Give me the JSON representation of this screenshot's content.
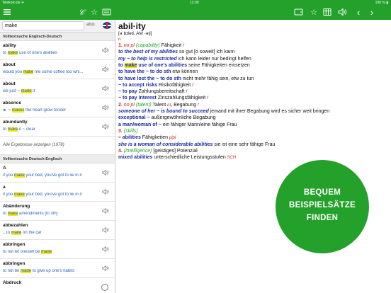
{
  "status": {
    "carrier": "Telekom.de ✈",
    "time": "12:00",
    "battery": "100 % ▮"
  },
  "icons": {
    "menu": "menu-icon",
    "handwriting": "handwriting-icon",
    "favorite": "star-icon",
    "keyboard": "keyboard-icon",
    "tablet": "tablet-icon",
    "table": "table-icon",
    "speaker": "speaker-icon",
    "back": "chevron-left-icon",
    "forward": "chevron-right-icon"
  },
  "colors": {
    "brand_green": "#23a12a",
    "highlight": "#f3e61a",
    "headword_blue": "#1c2a9e",
    "example_blue": "#2c63b8",
    "grammar_red": "#c22",
    "sense_green": "#22a32a"
  },
  "search": {
    "value": "make",
    "tool": "ab◎"
  },
  "left": {
    "section_en": "Volltextsuche Englisch-Deutsch",
    "en_results": [
      {
        "hw": "ability",
        "pre": "to ",
        "hl": "make",
        "post": " use of one's abilities"
      },
      {
        "hw": "about",
        "pre": "would you ",
        "hl": "make",
        "post": " me some coffee too whi..."
      },
      {
        "hw": "about",
        "pre": "we just ~ ",
        "hl": "made",
        "post": " it"
      },
      {
        "hw": "absence",
        "pre": "► ~ ",
        "hl": "makes",
        "post": " the heart grow fonder"
      },
      {
        "hw": "abundantly",
        "pre": "to ",
        "hl": "make",
        "post": " it ~ clear"
      }
    ],
    "all_results": "Alle Ergebnisse anzeigen (1978)",
    "section_de": "Volltextsuche Deutsch-Englisch",
    "de_results": [
      {
        "hw": "A",
        "pre": "if you ",
        "hl": "make",
        "post": " your bed, you've got to lie in it"
      },
      {
        "hw": "a",
        "pre": "if you ",
        "hl": "make",
        "post": " your bed, you've got to lie in it"
      },
      {
        "hw": "Abänderung",
        "pre": "to ",
        "hl": "make",
        "post": " amendments [to sth]"
      },
      {
        "hw": "abbezahlen",
        "pre": "...to ",
        "hl": "make",
        "post": " on the car"
      },
      {
        "hw": "abbringen",
        "pre": "to not let oneself be ",
        "hl": "made",
        "post": ""
      },
      {
        "hw": "abbringen",
        "pre": "to not be ",
        "hl": "made",
        "post": " to give up one's habits"
      },
      {
        "hw": "Abdruck",
        "pre": "",
        "hl": "",
        "post": ""
      }
    ]
  },
  "entry": {
    "headword": "abil·ity",
    "pronunciation": "[əˈbɪləti, AM -əţi]",
    "pos": "n",
    "lines": [
      {
        "num": "1.",
        "gram": " no pl ",
        "sense": "(capability)",
        "de": " Fähigkeit ",
        "g": "f"
      },
      {
        "eni": "to the best of my abilities",
        "de": " so gut [o soweit] ich kann"
      },
      {
        "eni": "my ~ to help is restricted",
        "de": " ich kann leider nur bedingt helfen"
      },
      {
        "en1": "to ",
        "hl": "make",
        "en2": " use of one's abilities",
        "de": " seine Fähigkeiten einsetzen"
      },
      {
        "en1": "to have the ~ to do sth",
        "de": " etw können"
      },
      {
        "en1": "to have lost the ~ to do sth",
        "de": " nicht mehr fähig sein, etw zu tun"
      },
      {
        "en1": "~ to accept risks",
        "de": " Risikofähigkeit ",
        "g": "f"
      },
      {
        "en1": "~ to pay",
        "de": " Zahlungsbereitschaft ",
        "g": "f"
      },
      {
        "en1": "~ to pay interest",
        "de": " Zinszahlungsfähigkeit ",
        "g": "f"
      },
      {
        "num": "2.",
        "gram": " no pl ",
        "sense": "(talent)",
        "de": " Talent ",
        "g": "nt",
        "de2": ", Begabung ",
        "g2": "f"
      },
      {
        "eni": "someone of her ~ is bound to succeed",
        "de": " jemand mit ihrer Begabung wird es sicher weit bringen"
      },
      {
        "en1": "exceptional ~",
        "de": " außergewöhnliche Begabung"
      },
      {
        "en1": "a man/woman of ~",
        "de": " ein fähiger Mann/eine fähige Frau"
      },
      {
        "num": "3.",
        "sense": " (skills)"
      },
      {
        "gram": "≈",
        "en1": " abilities",
        "g": " pl",
        "de": " Fähigkeiten ",
        "g2": "pl"
      },
      {
        "eni": "she is a woman of considerable abilities",
        "de": " sie ist eine sehr fähige Frau"
      },
      {
        "num": "4.",
        "sense": " (intelligence)",
        "de": " [geistiges] Potenzial"
      },
      {
        "en1": "mixed abilities",
        "g": " SCH",
        "de": " unterschiedliche Leistungsstufen"
      }
    ]
  },
  "promo": {
    "line1": "BEQUEM",
    "line2": "BEISPIELSÄTZE",
    "line3": "FINDEN"
  }
}
